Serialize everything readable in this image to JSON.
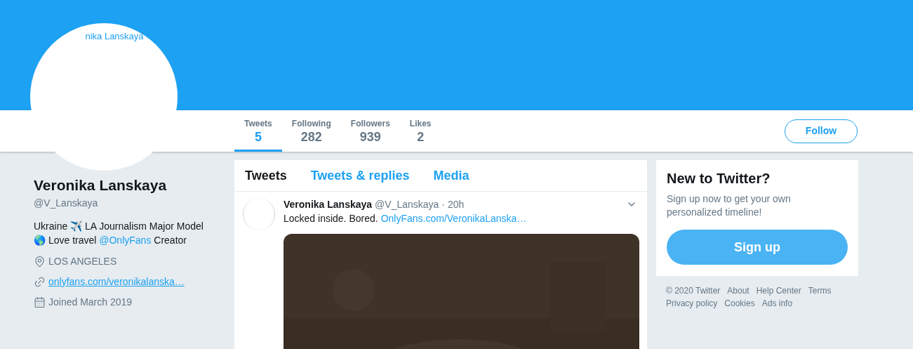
{
  "avatar": {
    "alt_text": "nika Lanskaya"
  },
  "stats": [
    {
      "label": "Tweets",
      "value": "5",
      "selected": true
    },
    {
      "label": "Following",
      "value": "282",
      "selected": false
    },
    {
      "label": "Followers",
      "value": "939",
      "selected": false
    },
    {
      "label": "Likes",
      "value": "2",
      "selected": false
    }
  ],
  "follow_button": "Follow",
  "profile": {
    "name": "Veronika Lanskaya",
    "handle": "@V_Lanskaya",
    "bio": [
      {
        "kind": "text",
        "text": "Ukraine ✈️ LA Journalism Major Model 🌎 Love travel"
      },
      {
        "kind": "mention",
        "text": "@OnlyFans"
      },
      {
        "kind": "text",
        "text": "Creator"
      }
    ],
    "location": "LOS ANGELES",
    "website": "onlyfans.com/veronikalanska…",
    "joined": "Joined March 2019"
  },
  "timeline_tabs": [
    {
      "label": "Tweets",
      "selected": true
    },
    {
      "label": "Tweets & replies",
      "selected": false
    },
    {
      "label": "Media",
      "selected": false
    }
  ],
  "tweet": {
    "name": "Veronika Lanskaya",
    "handle": "@V_Lanskaya",
    "time": "· 20h",
    "text": "Locked inside. Bored.",
    "link": "OnlyFans.com/VeronikaLanska…"
  },
  "signup_card": {
    "title": "New to Twitter?",
    "text": "Sign up now to get your own personalized timeline!",
    "button": "Sign up"
  },
  "footer_links": [
    "© 2020 Twitter",
    "About",
    "Help Center",
    "Terms",
    "Privacy policy",
    "Cookies",
    "Ads info"
  ]
}
